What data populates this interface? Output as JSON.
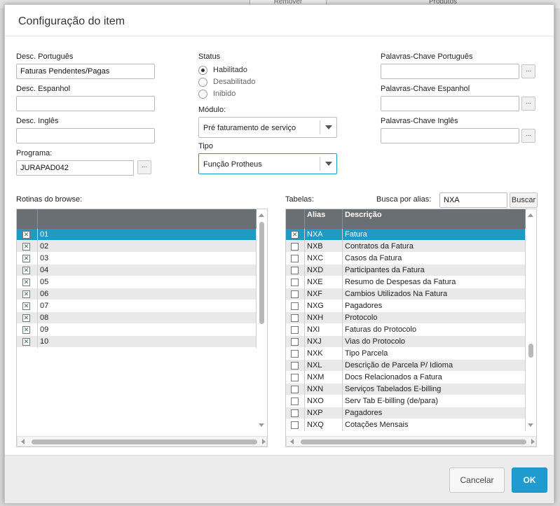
{
  "background": {
    "remover_label": "Remover",
    "produtos_label": "Produtos"
  },
  "dialog": {
    "title": "Configuração do item"
  },
  "form": {
    "desc_portugues": {
      "label": "Desc. Português",
      "value": "Faturas Pendentes/Pagas"
    },
    "desc_espanhol": {
      "label": "Desc. Espanhol",
      "value": ""
    },
    "desc_ingles": {
      "label": "Desc. Inglês",
      "value": ""
    },
    "programa": {
      "label": "Programa:",
      "value": "JURAPAD042",
      "lookup": "..."
    },
    "status": {
      "label": "Status",
      "options": [
        {
          "label": "Habilitado",
          "selected": true
        },
        {
          "label": "Desabilitado",
          "selected": false
        },
        {
          "label": "Inibido",
          "selected": false
        }
      ]
    },
    "modulo": {
      "label": "Módulo:",
      "value": "Pré faturamento de serviço"
    },
    "tipo": {
      "label": "Tipo",
      "value": "Função Protheus"
    },
    "palavras_pt": {
      "label": "Palavras-Chave Português",
      "value": "",
      "lookup": "..."
    },
    "palavras_es": {
      "label": "Palavras-Chave Espanhol",
      "value": "",
      "lookup": "..."
    },
    "palavras_en": {
      "label": "Palavras-Chave Inglês",
      "value": "",
      "lookup": "..."
    }
  },
  "rotinas": {
    "label": "Rotinas do browse:",
    "rows": [
      {
        "checked": true,
        "value": "01",
        "selected": true
      },
      {
        "checked": true,
        "value": "02"
      },
      {
        "checked": true,
        "value": "03"
      },
      {
        "checked": true,
        "value": "04"
      },
      {
        "checked": true,
        "value": "05"
      },
      {
        "checked": true,
        "value": "06"
      },
      {
        "checked": true,
        "value": "07"
      },
      {
        "checked": true,
        "value": "08"
      },
      {
        "checked": true,
        "value": "09"
      },
      {
        "checked": true,
        "value": "10"
      }
    ]
  },
  "tabelas": {
    "label": "Tabelas:",
    "busca_label": "Busca por alias:",
    "busca_value": "NXA",
    "buscar_button": "Buscar",
    "columns": [
      "Alias",
      "Descrição"
    ],
    "rows": [
      {
        "checked": true,
        "alias": "NXA",
        "descricao": "Fatura",
        "selected": true
      },
      {
        "checked": false,
        "alias": "NXB",
        "descricao": "Contratos da Fatura"
      },
      {
        "checked": false,
        "alias": "NXC",
        "descricao": "Casos da Fatura"
      },
      {
        "checked": false,
        "alias": "NXD",
        "descricao": "Participantes da Fatura"
      },
      {
        "checked": false,
        "alias": "NXE",
        "descricao": "Resumo de Despesas da Fatura"
      },
      {
        "checked": false,
        "alias": "NXF",
        "descricao": "Cambios Utilizados Na Fatura"
      },
      {
        "checked": false,
        "alias": "NXG",
        "descricao": "Pagadores"
      },
      {
        "checked": false,
        "alias": "NXH",
        "descricao": "Protocolo"
      },
      {
        "checked": false,
        "alias": "NXI",
        "descricao": "Faturas do Protocolo"
      },
      {
        "checked": false,
        "alias": "NXJ",
        "descricao": "Vias do Protocolo"
      },
      {
        "checked": false,
        "alias": "NXK",
        "descricao": "Tipo Parcela"
      },
      {
        "checked": false,
        "alias": "NXL",
        "descricao": "Descrição de Parcela P/ Idioma"
      },
      {
        "checked": false,
        "alias": "NXM",
        "descricao": "Docs Relacionados a Fatura"
      },
      {
        "checked": false,
        "alias": "NXN",
        "descricao": "Serviços Tabelados E-billing"
      },
      {
        "checked": false,
        "alias": "NXO",
        "descricao": "Serv Tab E-billing (de/para)"
      },
      {
        "checked": false,
        "alias": "NXP",
        "descricao": "Pagadores"
      },
      {
        "checked": false,
        "alias": "NXQ",
        "descricao": "Cotações Mensais"
      }
    ]
  },
  "footer": {
    "cancel_label": "Cancelar",
    "ok_label": "OK"
  },
  "colors": {
    "accent": "#1f9bd0",
    "selected_row": "#1e9ac5",
    "grid_header": "#6a6f73",
    "checkmark": "#2a6b5a"
  }
}
